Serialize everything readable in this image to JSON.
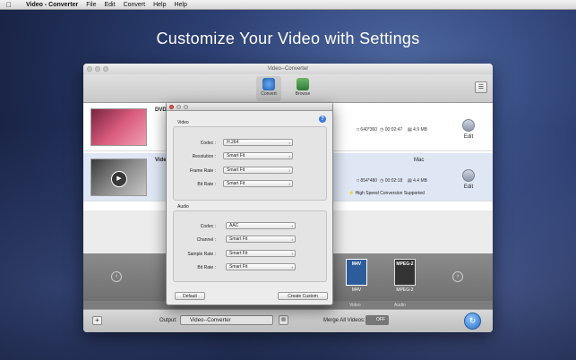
{
  "menubar": {
    "app": "Video - Converter",
    "items": [
      "File",
      "Edit",
      "Convert",
      "Help",
      "Help"
    ]
  },
  "headline": "Customize Your Video with Settings",
  "window": {
    "title": "Video--Converter",
    "toolbar": {
      "convert_label": "Convert",
      "browse_label": "Browse"
    },
    "rows": [
      {
        "name": "DVD",
        "res": "640*360",
        "duration": "00:02:47",
        "size": "4.9 MB",
        "edit": "Edit"
      },
      {
        "name": "Vide",
        "name_right": "Mac",
        "res": "854*480",
        "duration": "00:02:18",
        "size": "4.4 MB",
        "hs": "High Speed Conversion Supported",
        "edit": "Edit"
      }
    ],
    "formats": [
      {
        "badge": "M4V",
        "label": "M4V"
      },
      {
        "badge": "MPEG-2",
        "label": "MPEG-2"
      }
    ],
    "subtabs": [
      "Video",
      "Audio"
    ],
    "bottom": {
      "output_label": "Output:",
      "output_value": "Video--Converter",
      "merge_label": "Merge All Videos:",
      "toggle": "OFF"
    }
  },
  "dialog": {
    "video_section": "Video",
    "audio_section": "Audio",
    "video_fields": [
      {
        "label": "Codec :",
        "value": "H.264"
      },
      {
        "label": "Resolution :",
        "value": "Smart Fit"
      },
      {
        "label": "Frame Rate :",
        "value": "Smart Fit"
      },
      {
        "label": "Bit Rate :",
        "value": "Smart Fit"
      }
    ],
    "audio_fields": [
      {
        "label": "Codec :",
        "value": "AAC"
      },
      {
        "label": "Channel :",
        "value": "Smart Fit"
      },
      {
        "label": "Sample Rate :",
        "value": "Smart Fit"
      },
      {
        "label": "Bit Rate :",
        "value": "Smart Fit"
      }
    ],
    "default_button": "Default",
    "create_button": "Create Custom"
  }
}
